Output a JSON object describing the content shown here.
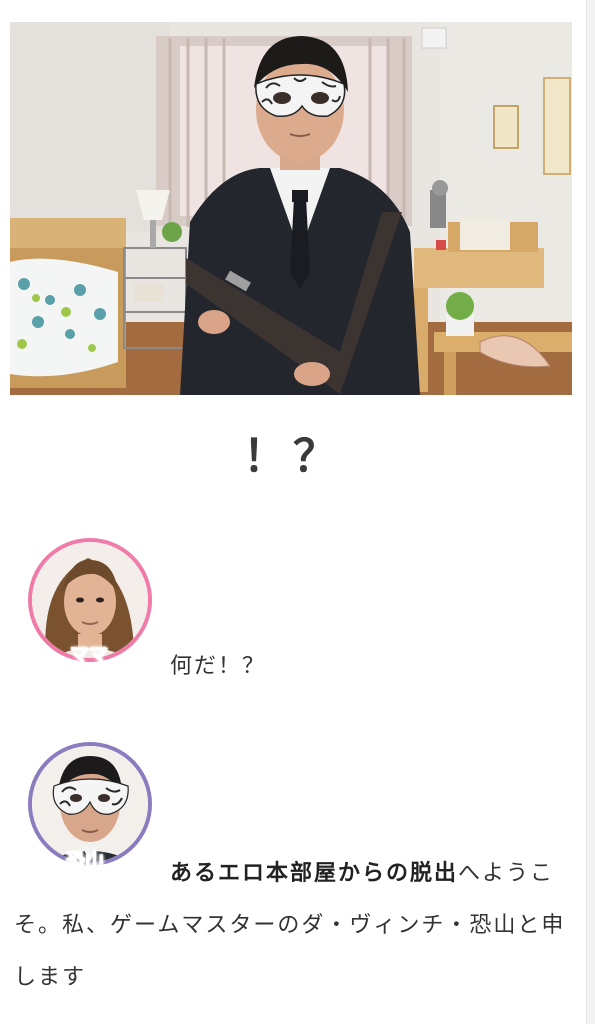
{
  "heading": "！？",
  "dialogues": [
    {
      "speaker": "ママ",
      "text": "何だ！？"
    },
    {
      "speaker": "恐山",
      "bold": "あるエロ本部屋からの脱出",
      "text": "へようこそ。私、ゲームマスターのダ・ヴィンチ・恐山と申します"
    }
  ]
}
